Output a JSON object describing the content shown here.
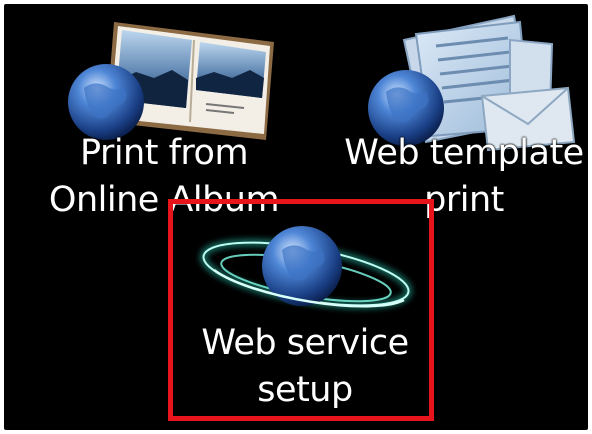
{
  "menu": {
    "items": [
      {
        "label_line1": "Print from",
        "label_line2": "Online Album",
        "icon": "globe-photo-album-icon"
      },
      {
        "label_line1": "Web template",
        "label_line2": "print",
        "icon": "globe-document-envelope-icon"
      },
      {
        "label_line1": "Web service",
        "label_line2": "setup",
        "icon": "globe-orbit-icon"
      }
    ],
    "selected_index": 2
  },
  "colors": {
    "screen_background": "#000000",
    "label_text": "#ffffff",
    "highlight": "#e8141b",
    "glow": "#7fffe8",
    "globe": "#2a5fb0"
  }
}
